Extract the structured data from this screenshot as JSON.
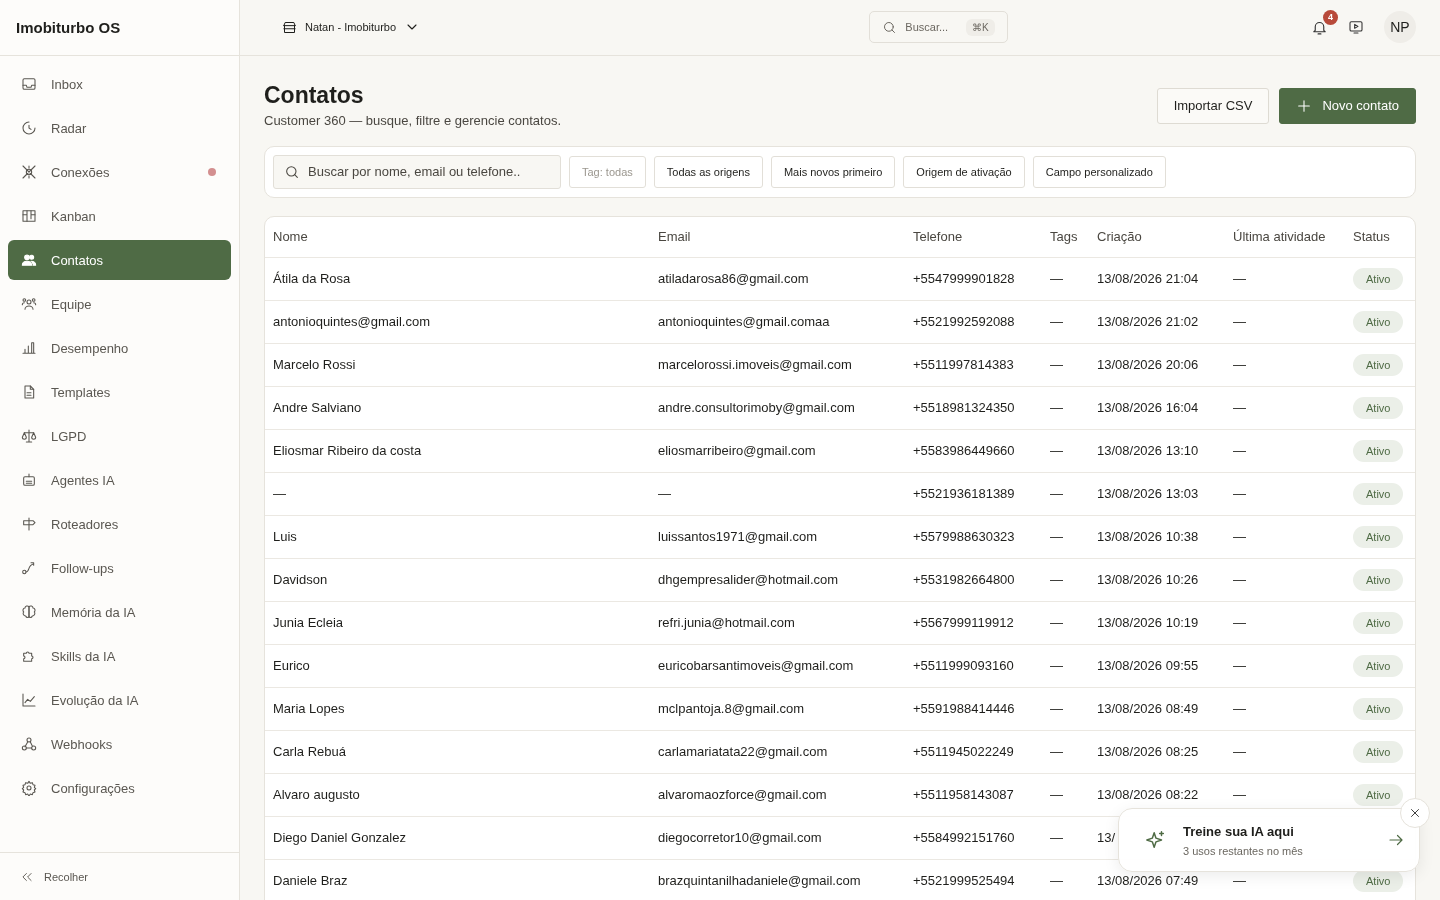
{
  "sidebar": {
    "brand": "Imobiturbo OS",
    "items": [
      {
        "label": "Inbox",
        "selected": false,
        "alert": false
      },
      {
        "label": "Radar",
        "selected": false,
        "alert": false
      },
      {
        "label": "Conexões",
        "selected": false,
        "alert": true
      },
      {
        "label": "Kanban",
        "selected": false,
        "alert": false
      },
      {
        "label": "Contatos",
        "selected": true,
        "alert": false
      },
      {
        "label": "Equipe",
        "selected": false,
        "alert": false
      },
      {
        "label": "Desempenho",
        "selected": false,
        "alert": false
      },
      {
        "label": "Templates",
        "selected": false,
        "alert": false
      },
      {
        "label": "LGPD",
        "selected": false,
        "alert": false
      },
      {
        "label": "Agentes IA",
        "selected": false,
        "alert": false
      },
      {
        "label": "Roteadores",
        "selected": false,
        "alert": false
      },
      {
        "label": "Follow-ups",
        "selected": false,
        "alert": false
      },
      {
        "label": "Memória da IA",
        "selected": false,
        "alert": false
      },
      {
        "label": "Skills da IA",
        "selected": false,
        "alert": false
      },
      {
        "label": "Evolução da IA",
        "selected": false,
        "alert": false
      },
      {
        "label": "Webhooks",
        "selected": false,
        "alert": false
      },
      {
        "label": "Configurações",
        "selected": false,
        "alert": false
      }
    ],
    "collapse": "Recolher"
  },
  "topbar": {
    "workspace": "Natan - Imobiturbo",
    "search": {
      "placeholder": "Buscar...",
      "shortcut": "⌘K"
    },
    "notifications": "4",
    "avatar": "NP"
  },
  "page": {
    "title": "Contatos",
    "subtitle": "Customer 360 — busque, filtre e gerencie contatos.",
    "buttons": [
      "Importar CSV",
      "Novo contato"
    ]
  },
  "filters": {
    "search": {
      "placeholder": "Buscar por nome, email ou telefone.."
    },
    "tag": "Tag: todas",
    "chips": [
      "Todas as origens",
      "Mais novos primeiro",
      "Origem de ativação",
      "Campo personalizado"
    ]
  },
  "table": {
    "columns": [
      "Nome",
      "Email",
      "Telefone",
      "Tags",
      "Criação",
      "Última atividade",
      "Status"
    ],
    "rows": [
      [
        "Átila da Rosa",
        "atiladarosa86@gmail.com",
        "+5547999901828",
        "—",
        "13/08/2026 21:04",
        "—",
        "Ativo"
      ],
      [
        "antonioquintes@gmail.com",
        "antonioquintes@gmail.comaa",
        "+5521992592088",
        "—",
        "13/08/2026 21:02",
        "—",
        "Ativo"
      ],
      [
        "Marcelo Rossi",
        "marcelorossi.imoveis@gmail.com",
        "+5511997814383",
        "—",
        "13/08/2026 20:06",
        "—",
        "Ativo"
      ],
      [
        "Andre Salviano",
        "andre.consultorimoby@gmail.com",
        "+5518981324350",
        "—",
        "13/08/2026 16:04",
        "—",
        "Ativo"
      ],
      [
        "Eliosmar Ribeiro da costa",
        "eliosmarribeiro@gmail.com",
        "+5583986449660",
        "—",
        "13/08/2026 13:10",
        "—",
        "Ativo"
      ],
      [
        "—",
        "—",
        "+5521936181389",
        "—",
        "13/08/2026 13:03",
        "—",
        "Ativo"
      ],
      [
        "Luis",
        "luissantos1971@gmail.com",
        "+5579988630323",
        "—",
        "13/08/2026 10:38",
        "—",
        "Ativo"
      ],
      [
        "Davidson",
        "dhgempresalider@hotmail.com",
        "+5531982664800",
        "—",
        "13/08/2026 10:26",
        "—",
        "Ativo"
      ],
      [
        "Junia Ecleia",
        "refri.junia@hotmail.com",
        "+5567999119912",
        "—",
        "13/08/2026 10:19",
        "—",
        "Ativo"
      ],
      [
        "Eurico",
        "euricobarsantimoveis@gmail.com",
        "+5511999093160",
        "—",
        "13/08/2026 09:55",
        "—",
        "Ativo"
      ],
      [
        "Maria Lopes",
        "mclpantoja.8@gmail.com",
        "+5591988414446",
        "—",
        "13/08/2026 08:49",
        "—",
        "Ativo"
      ],
      [
        "Carla Rebuá",
        "carlamariatata22@gmail.com",
        "+5511945022249",
        "—",
        "13/08/2026 08:25",
        "—",
        "Ativo"
      ],
      [
        "Alvaro augusto",
        "alvaromaozforce@gmail.com",
        "+5511958143087",
        "—",
        "13/08/2026 08:22",
        "—",
        "Ativo"
      ],
      [
        "Diego Daniel Gonzalez",
        "diegocorretor10@gmail.com",
        "+5584992151760",
        "—",
        "13/",
        "",
        ""
      ],
      [
        "Daniele Braz",
        "brazquintanilhadaniele@gmail.com",
        "+5521999525494",
        "—",
        "13/08/2026 07:49",
        "—",
        "Ativo"
      ]
    ]
  },
  "toast": {
    "title": "Treine sua IA aqui",
    "text": "3 usos restantes no mês"
  }
}
